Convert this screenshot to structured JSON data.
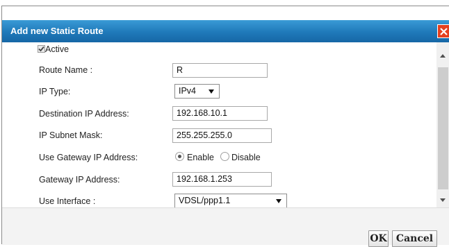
{
  "dialog": {
    "title": "Add new Static Route"
  },
  "form": {
    "active_label": "Active",
    "active_checked": true,
    "route_name": {
      "label": "Route Name :",
      "value": "R"
    },
    "ip_type": {
      "label": "IP Type:",
      "value": "IPv4"
    },
    "destination_ip": {
      "label": "Destination IP Address:",
      "value": "192.168.10.1"
    },
    "subnet_mask": {
      "label": "IP Subnet Mask:",
      "value": "255.255.255.0"
    },
    "use_gateway": {
      "label": "Use Gateway IP Address:",
      "enable_label": "Enable",
      "disable_label": "Disable",
      "selected": "Enable"
    },
    "gateway_ip": {
      "label": "Gateway IP Address:",
      "value": "192.168.1.253"
    },
    "use_interface": {
      "label": "Use Interface :",
      "value": "VDSL/ppp1.1"
    }
  },
  "footer": {
    "ok_label": "OK",
    "cancel_label": "Cancel"
  },
  "colors": {
    "title_bar": "#1f79b9",
    "close_button": "#e5401e"
  }
}
